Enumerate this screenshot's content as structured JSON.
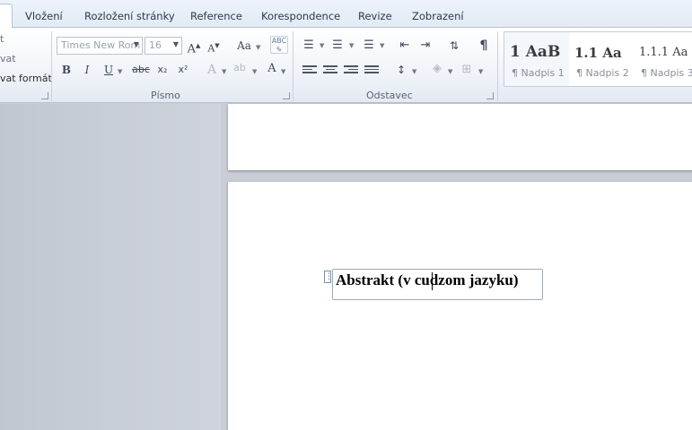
{
  "tabs": [
    "Vložení",
    "Rozložení stránky",
    "Reference",
    "Korespondence",
    "Revize",
    "Zobrazení"
  ],
  "clipboard": {
    "item1": "t",
    "item2": "vat",
    "item3": "vat formát"
  },
  "font_group": {
    "label": "Písmo",
    "font_name": "Times New Rom",
    "font_size": "16",
    "grow_label": "A",
    "shrink_label": "A",
    "case_label": "Aa",
    "bold": "B",
    "italic": "I",
    "underline": "U",
    "strike": "abc",
    "subscript": "x₂",
    "superscript": "x²",
    "text_effect": "A",
    "highlight": "ab",
    "font_color": "A"
  },
  "paragraph_group": {
    "label": "Odstavec",
    "pilcrow": "¶"
  },
  "styles": [
    {
      "sample": "1  AaB",
      "name": "¶ Nadpis 1"
    },
    {
      "sample": "1.1  Aa",
      "name": "¶ Nadpis 2"
    },
    {
      "sample": "1.1.1  Aa",
      "name": "¶ Nadpis 3"
    }
  ],
  "document": {
    "heading_before_caret": "Abstrakt (v c",
    "heading_after_caret": "udzom jazyku)"
  },
  "colors": {
    "accent": "#2b579a",
    "ribbon_border": "#b6c3d6",
    "workspace": "#c9ced6"
  }
}
